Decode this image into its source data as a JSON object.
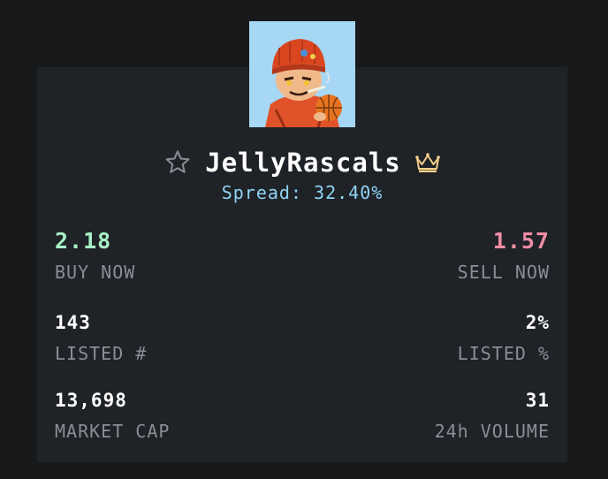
{
  "collection": {
    "name": "JellyRascals",
    "spread_text": "Spread: 32.40%",
    "favorite_icon": "star-outline-icon",
    "badge_icon": "crown-icon"
  },
  "stats": {
    "buy_now": {
      "value": "2.18",
      "label": "BUY NOW"
    },
    "sell_now": {
      "value": "1.57",
      "label": "SELL NOW"
    },
    "listed_count": {
      "value": "143",
      "label": "LISTED #"
    },
    "listed_percent": {
      "value": "2%",
      "label": "LISTED %"
    },
    "market_cap": {
      "value": "13,698",
      "label": "MARKET CAP"
    },
    "volume_24h": {
      "value": "31",
      "label": "24h VOLUME"
    }
  },
  "colors": {
    "background": "#18191b",
    "card": "#1f2226",
    "buy": "#a8f0c6",
    "sell": "#f08da6",
    "spread": "#8fd3f4",
    "label": "#8a8f96",
    "crown": "#f5d08a"
  }
}
